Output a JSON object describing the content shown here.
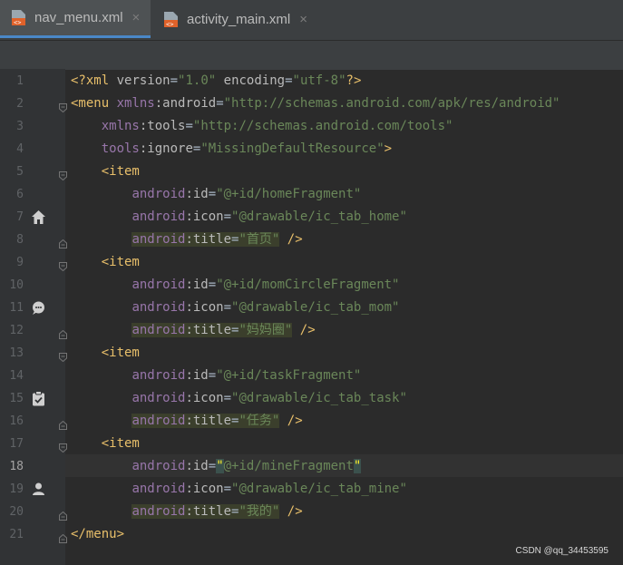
{
  "tabs": [
    {
      "label": "nav_menu.xml",
      "close": "×",
      "active": true,
      "icon": "xml-file-icon"
    },
    {
      "label": "activity_main.xml",
      "close": "×",
      "active": false,
      "icon": "xml-file-icon"
    }
  ],
  "editor": {
    "current_line": 18,
    "lines": [
      {
        "n": "1",
        "t": "<?xml version=\"1.0\" encoding=\"utf-8\"?>"
      },
      {
        "n": "2",
        "t": "<menu xmlns:android=\"http://schemas.android.com/apk/res/android\""
      },
      {
        "n": "3",
        "t": "    xmlns:tools=\"http://schemas.android.com/tools\""
      },
      {
        "n": "4",
        "t": "    tools:ignore=\"MissingDefaultResource\">"
      },
      {
        "n": "5",
        "t": "    <item"
      },
      {
        "n": "6",
        "t": "        android:id=\"@+id/homeFragment\""
      },
      {
        "n": "7",
        "t": "        android:icon=\"@drawable/ic_tab_home\""
      },
      {
        "n": "8",
        "t": "        android:title=\"首页\" />"
      },
      {
        "n": "9",
        "t": "    <item"
      },
      {
        "n": "10",
        "t": "        android:id=\"@+id/momCircleFragment\""
      },
      {
        "n": "11",
        "t": "        android:icon=\"@drawable/ic_tab_mom\""
      },
      {
        "n": "12",
        "t": "        android:title=\"妈妈圈\" />"
      },
      {
        "n": "13",
        "t": "    <item"
      },
      {
        "n": "14",
        "t": "        android:id=\"@+id/taskFragment\""
      },
      {
        "n": "15",
        "t": "        android:icon=\"@drawable/ic_tab_task\""
      },
      {
        "n": "16",
        "t": "        android:title=\"任务\" />"
      },
      {
        "n": "17",
        "t": "    <item"
      },
      {
        "n": "18",
        "t": "        android:id=\"@+id/mineFragment\""
      },
      {
        "n": "19",
        "t": "        android:icon=\"@drawable/ic_tab_mine\""
      },
      {
        "n": "20",
        "t": "        android:title=\"我的\" />"
      },
      {
        "n": "21",
        "t": "</menu>"
      }
    ],
    "gutter_icons": [
      {
        "line": 7,
        "icon": "home-icon"
      },
      {
        "line": 11,
        "icon": "chat-bubble-icon"
      },
      {
        "line": 15,
        "icon": "clipboard-icon"
      },
      {
        "line": 19,
        "icon": "person-icon"
      }
    ]
  },
  "watermark": "CSDN @qq_34453595",
  "colors": {
    "tag": "#e8bf6a",
    "namespace": "#9876aa",
    "attribute": "#bababa",
    "string": "#6a8759",
    "text": "#a9b7c6",
    "accent": "#4a88c7"
  }
}
